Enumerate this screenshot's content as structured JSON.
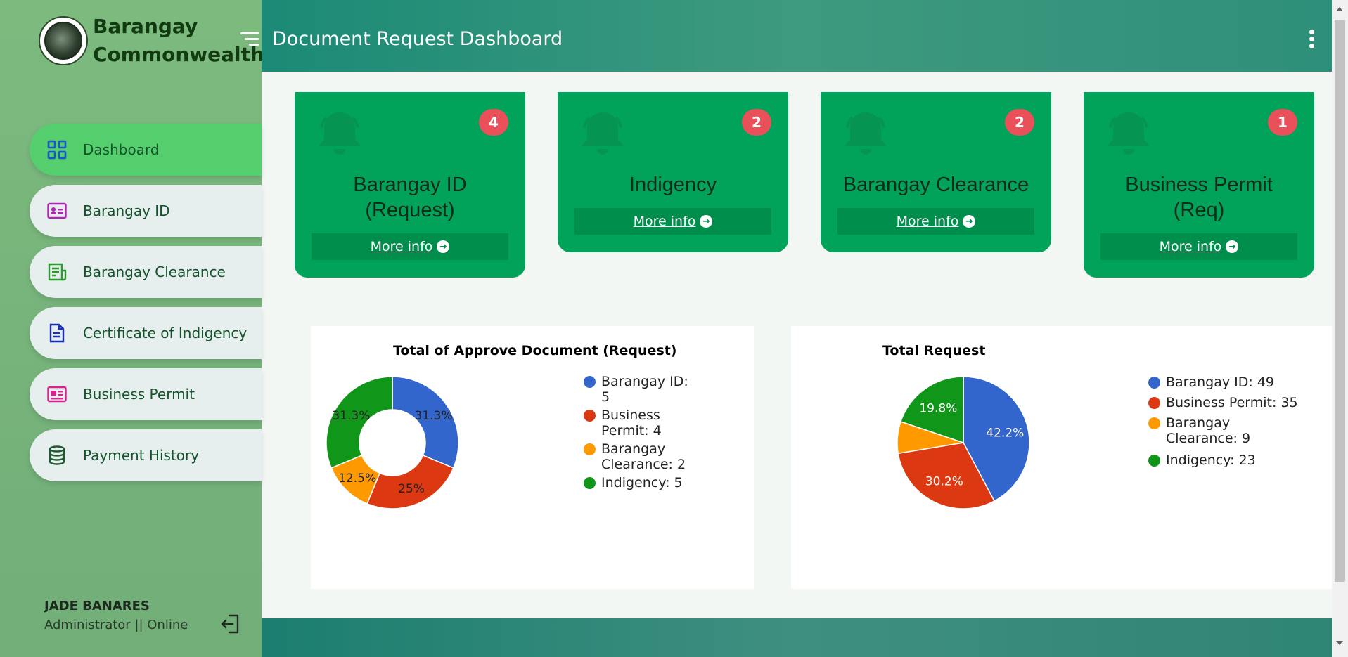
{
  "brand": {
    "line1": "Barangay",
    "line2": "Commonwealth"
  },
  "header": {
    "title": "Document Request Dashboard"
  },
  "sidebar": {
    "items": [
      {
        "label": "Dashboard",
        "icon": "grid-icon",
        "color": "#1a56c8",
        "active": true
      },
      {
        "label": "Barangay ID",
        "icon": "id-card-icon",
        "color": "#b025b8"
      },
      {
        "label": "Barangay Clearance",
        "icon": "clearance-doc-icon",
        "color": "#2e9a2e"
      },
      {
        "label": "Certificate of Indigency",
        "icon": "document-icon",
        "color": "#1a2fb8"
      },
      {
        "label": "Business Permit",
        "icon": "permit-card-icon",
        "color": "#d6238f"
      },
      {
        "label": "Payment History",
        "icon": "database-icon",
        "color": "#1e5a2e"
      }
    ]
  },
  "user": {
    "name": "JADE BANARES",
    "role": "Administrator || Online"
  },
  "cards": [
    {
      "title_line1": "Barangay ID",
      "title_line2": "(Request)",
      "count": "4",
      "link": "More info"
    },
    {
      "title_line1": "Indigency",
      "title_line2": "",
      "count": "2",
      "link": "More info"
    },
    {
      "title_line1": "Barangay Clearance",
      "title_line2": "",
      "count": "2",
      "link": "More info"
    },
    {
      "title_line1": "Business Permit",
      "title_line2": "(Req)",
      "count": "1",
      "link": "More info"
    }
  ],
  "colors": {
    "blue": "#3366cc",
    "red": "#dc3912",
    "orange": "#ff9900",
    "green": "#109618",
    "card": "#00a359",
    "badge": "#e9505a"
  },
  "chart_data": [
    {
      "type": "pie",
      "title": "Total of Approve Document (Request)",
      "donut": true,
      "categories": [
        "Barangay ID",
        "Business Permit",
        "Barangay Clearance",
        "Indigency"
      ],
      "values": [
        5,
        4,
        2,
        5
      ],
      "percent_labels": [
        "31.3%",
        "25%",
        "12.5%",
        "31.3%"
      ],
      "legend": [
        {
          "line1": "Barangay ID:",
          "line2": "5"
        },
        {
          "line1": "Business",
          "line2": "Permit: 4"
        },
        {
          "line1": "Barangay",
          "line2": "Clearance: 2"
        },
        {
          "line1": "Indigency: 5",
          "line2": ""
        }
      ],
      "legend_position": "right"
    },
    {
      "type": "pie",
      "title": "Total Request",
      "donut": false,
      "categories": [
        "Barangay ID",
        "Business Permit",
        "Barangay Clearance",
        "Indigency"
      ],
      "values": [
        49,
        35,
        9,
        23
      ],
      "percent_labels": [
        "42.2%",
        "30.2%",
        "",
        "19.8%"
      ],
      "legend": [
        {
          "line1": "Barangay ID: 49",
          "line2": ""
        },
        {
          "line1": "Business Permit: 35",
          "line2": ""
        },
        {
          "line1": "Barangay",
          "line2": "Clearance: 9"
        },
        {
          "line1": "Indigency: 23",
          "line2": ""
        }
      ],
      "legend_position": "right"
    }
  ]
}
